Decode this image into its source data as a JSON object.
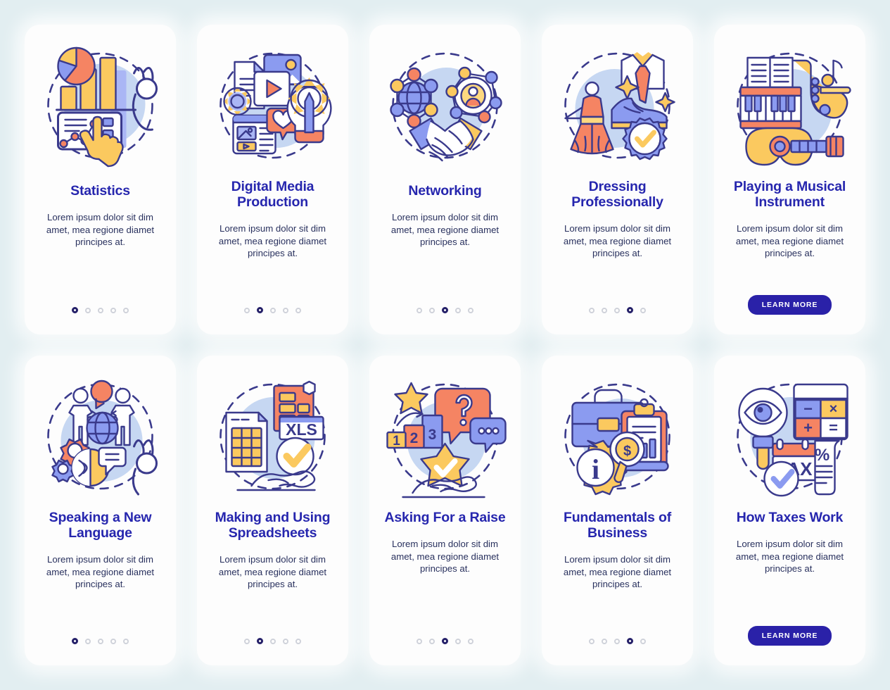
{
  "page": {
    "background_color": "#e2eef1",
    "card_background": "#fdfdfd",
    "title_color": "#2626ae",
    "body_color": "#29315e",
    "accent_button_color": "#2a21a8",
    "active_dot_color": "#241f68",
    "inactive_dot_color": "#cfd2da"
  },
  "shared": {
    "description": "Lorem ipsum dolor sit dim amet, mea regione diamet principes at.",
    "cta_label": "LEARN MORE",
    "dot_count": 5
  },
  "cards": [
    {
      "id": "statistics",
      "title": "Statistics",
      "icon": "statistics-illustration",
      "description": "Lorem ipsum dolor sit dim amet, mea regione diamet principes at.",
      "active_dot": 1,
      "has_cta": false
    },
    {
      "id": "digital-media-production",
      "title": "Digital Media Production",
      "icon": "digital-media-illustration",
      "description": "Lorem ipsum dolor sit dim amet, mea regione diamet principes at.",
      "active_dot": 2,
      "has_cta": false
    },
    {
      "id": "networking",
      "title": "Networking",
      "icon": "networking-illustration",
      "description": "Lorem ipsum dolor sit dim amet, mea regione diamet principes at.",
      "active_dot": 3,
      "has_cta": false
    },
    {
      "id": "dressing-professionally",
      "title": "Dressing Professionally",
      "icon": "dressing-illustration",
      "description": "Lorem ipsum dolor sit dim amet, mea regione diamet principes at.",
      "active_dot": 4,
      "has_cta": false
    },
    {
      "id": "playing-a-musical-instrument",
      "title": "Playing a Musical Instrument",
      "icon": "music-illustration",
      "description": "Lorem ipsum dolor sit dim amet, mea regione diamet principes at.",
      "active_dot": 0,
      "has_cta": true,
      "cta_label": "LEARN MORE"
    },
    {
      "id": "speaking-a-new-language",
      "title": "Speaking a New Language",
      "icon": "language-illustration",
      "description": "Lorem ipsum dolor sit dim amet, mea regione diamet principes at.",
      "active_dot": 1,
      "has_cta": false
    },
    {
      "id": "making-and-using-spreadsheets",
      "title": "Making and Using Spreadsheets",
      "icon": "spreadsheet-illustration",
      "description": "Lorem ipsum dolor sit dim amet, mea regione diamet principes at.",
      "active_dot": 2,
      "has_cta": false
    },
    {
      "id": "asking-for-a-raise",
      "title": "Asking For a Raise",
      "icon": "raise-illustration",
      "description": "Lorem ipsum dolor sit dim amet, mea regione diamet principes at.",
      "active_dot": 3,
      "has_cta": false
    },
    {
      "id": "fundamentals-of-business",
      "title": "Fundamentals of Business",
      "icon": "business-illustration",
      "description": "Lorem ipsum dolor sit dim amet, mea regione diamet principes at.",
      "active_dot": 4,
      "has_cta": false
    },
    {
      "id": "how-taxes-work",
      "title": "How Taxes Work",
      "icon": "taxes-illustration",
      "description": "Lorem ipsum dolor sit dim amet, mea regione diamet principes at.",
      "active_dot": 0,
      "has_cta": true,
      "cta_label": "LEARN MORE"
    }
  ],
  "illustration_labels": {
    "spreadsheet_file_type": "XLS",
    "podium_first": "1",
    "podium_second": "2",
    "podium_third": "3",
    "tax_label": "TAX",
    "calc_minus": "−",
    "calc_times": "×",
    "calc_plus": "+",
    "calc_equals": "=",
    "percent": "%",
    "question_mark": "?",
    "info_mark": "i",
    "dollar_mark": "$"
  }
}
